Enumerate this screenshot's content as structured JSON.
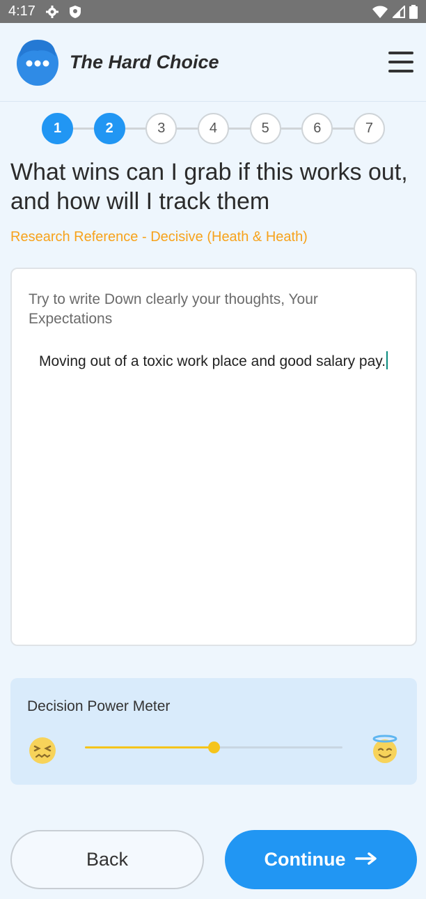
{
  "status_bar": {
    "time": "4:17",
    "left_icons": [
      "gear-icon",
      "shield-icon"
    ],
    "right_icons": [
      "wifi-icon",
      "signal-icon",
      "battery-icon"
    ]
  },
  "header": {
    "title": "The Hard Choice",
    "logo_icon": "chat-head-icon",
    "menu_icon": "hamburger-menu-icon"
  },
  "stepper": {
    "steps": [
      "1",
      "2",
      "3",
      "4",
      "5",
      "6",
      "7"
    ],
    "active_steps": 2
  },
  "question": {
    "text": "What wins can I grab if this works out, and how will I track them",
    "reference": "Research Reference - Decisive (Heath & Heath)"
  },
  "text_card": {
    "prompt": "Try to write Down clearly your thoughts, Your Expectations",
    "answer": "Moving out of a toxic work place and good salary pay."
  },
  "meter": {
    "title": "Decision Power Meter",
    "value_fraction": 0.5,
    "left_icon": "confounded-face-icon",
    "right_icon": "smiling-halo-face-icon"
  },
  "buttons": {
    "back_label": "Back",
    "continue_label": "Continue",
    "continue_icon": "arrow-right-icon"
  },
  "colors": {
    "accent": "#2196f3",
    "reference": "#f7a21b",
    "slider": "#f5c41b",
    "status_bar": "#737373"
  }
}
